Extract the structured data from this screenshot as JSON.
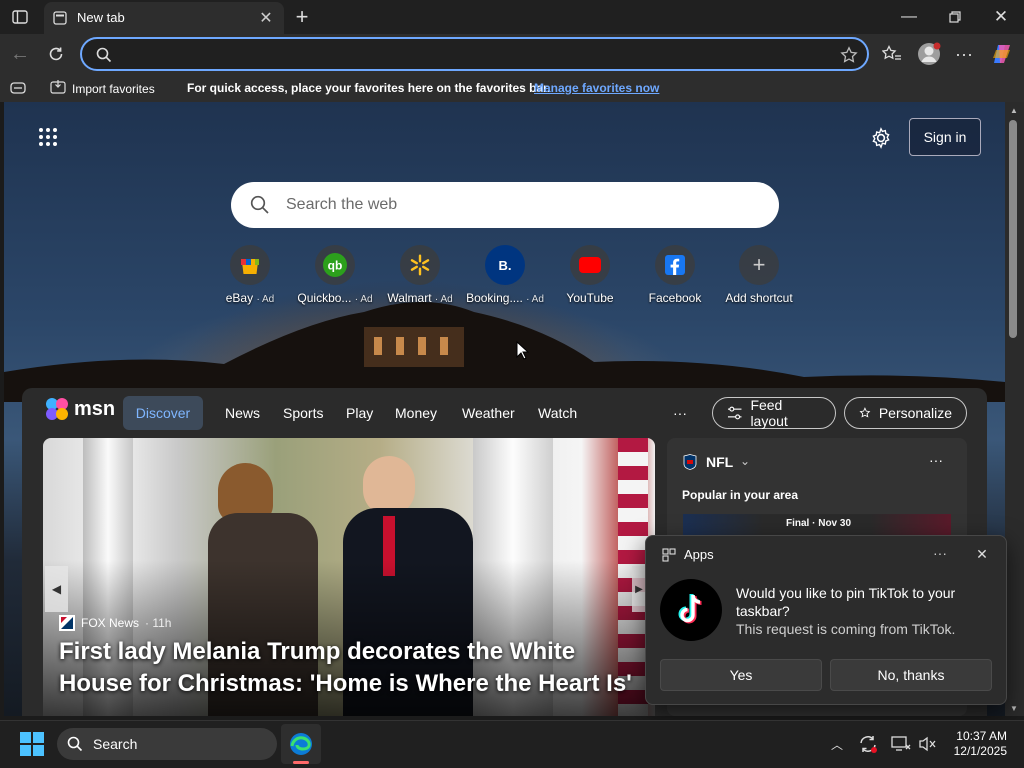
{
  "browser": {
    "tab_title": "New tab",
    "address_value": ""
  },
  "favorites_bar": {
    "import_label": "Import favorites",
    "message": "For quick access, place your favorites here on the favorites bar.",
    "manage_link": "Manage favorites now"
  },
  "newtab": {
    "signin_label": "Sign in",
    "search_placeholder": "Search the web",
    "tiles": [
      {
        "label": "eBay",
        "ad": "· Ad"
      },
      {
        "label": "Quickbo...",
        "ad": "· Ad"
      },
      {
        "label": "Walmart",
        "ad": "· Ad"
      },
      {
        "label": "Booking....",
        "ad": "· Ad"
      },
      {
        "label": "YouTube",
        "ad": ""
      },
      {
        "label": "Facebook",
        "ad": ""
      },
      {
        "label": "Add shortcut",
        "ad": ""
      }
    ],
    "booking_glyph": "B."
  },
  "feed": {
    "logo_text": "msn",
    "nav": [
      "Discover",
      "News",
      "Sports",
      "Play",
      "Money",
      "Weather",
      "Watch"
    ],
    "more": "···",
    "feed_layout_label": "Feed layout",
    "personalize_label": "Personalize",
    "hero": {
      "source": "FOX News",
      "age": "· 11h",
      "headline": "First lady Melania Trump decorates the White House for Christmas: 'Home is Where the Heart Is'"
    },
    "side_card": {
      "league": "NFL",
      "subtitle": "Popular in your area",
      "game_status": "Final · Nov 30"
    }
  },
  "notification": {
    "app_label": "Apps",
    "message": "Would you like to pin TikTok to your taskbar?",
    "sub": "This request is coming from TikTok.",
    "yes_label": "Yes",
    "no_label": "No, thanks"
  },
  "taskbar": {
    "search_label": "Search",
    "time": "10:37 AM",
    "date": "12/1/2025"
  },
  "colors": {
    "accent_link": "#6ea8ff",
    "youtube_red": "#ff0000",
    "facebook_blue": "#1877f2",
    "quickbooks_green": "#2ca01c",
    "walmart_blue": "#0071ce",
    "booking_blue": "#003580"
  }
}
